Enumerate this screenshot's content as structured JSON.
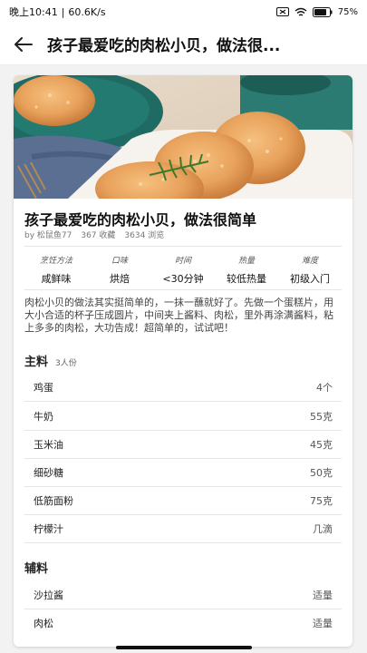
{
  "status": {
    "time": "晚上10:41",
    "speed": "60.6K/s",
    "battery": "75"
  },
  "header": {
    "title": "孩子最爱吃的肉松小贝，做法很..."
  },
  "recipe": {
    "title": "孩子最爱吃的肉松小贝，做法很简单",
    "author": "by 松鼠鱼77",
    "favorites": "367 收藏",
    "views": "3634 浏览",
    "attributes": [
      {
        "label": "烹饪方法",
        "value": "咸鲜味"
      },
      {
        "label": "口味",
        "value": "烘焙"
      },
      {
        "label": "时间",
        "value": "<30分钟"
      },
      {
        "label": "热量",
        "value": "较低热量"
      },
      {
        "label": "难度",
        "value": "初级入门"
      }
    ],
    "description": "肉松小贝的做法其实挺简单的，一抹一蘸就好了。先做一个蛋糕片，用大小合适的杯子压成圆片，中间夹上酱料、肉松，里外再涂满酱料，粘上多多的肉松，大功告成！超简单的，试试吧！"
  },
  "main_ingredients": {
    "title": "主料",
    "servings": "3人份",
    "items": [
      {
        "name": "鸡蛋",
        "amount": "4个"
      },
      {
        "name": "牛奶",
        "amount": "55克"
      },
      {
        "name": "玉米油",
        "amount": "45克"
      },
      {
        "name": "细砂糖",
        "amount": "50克"
      },
      {
        "name": "低筋面粉",
        "amount": "75克"
      },
      {
        "name": "柠檬汁",
        "amount": "几滴"
      }
    ]
  },
  "secondary_ingredients": {
    "title": "辅料",
    "items": [
      {
        "name": "沙拉酱",
        "amount": "适量"
      },
      {
        "name": "肉松",
        "amount": "适量"
      }
    ]
  }
}
